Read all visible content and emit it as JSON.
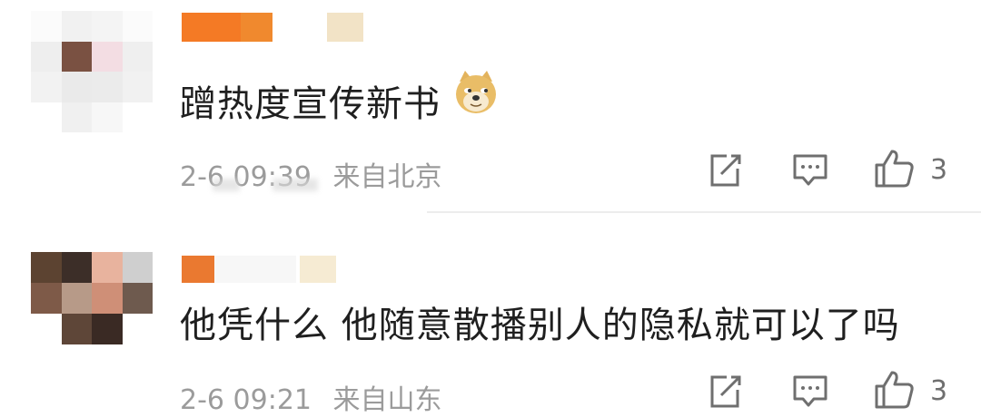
{
  "comments": [
    {
      "text": "蹭热度宣传新书",
      "date": "2-6 09:39",
      "location": "来自北京",
      "likes": "3",
      "emoji": "doge"
    },
    {
      "text": "他凭什么 他随意散播别人的隐私就可以了吗",
      "date": "2-6 09:21",
      "location": "来自山东",
      "likes": "3"
    }
  ],
  "icons": {
    "share": "share-icon",
    "comment": "comment-icon",
    "like": "thumbs-up-icon"
  },
  "colors": {
    "nickname_orange": "#f07a2a",
    "meta_gray": "#9b9b9b",
    "text": "#1f1f1f"
  }
}
